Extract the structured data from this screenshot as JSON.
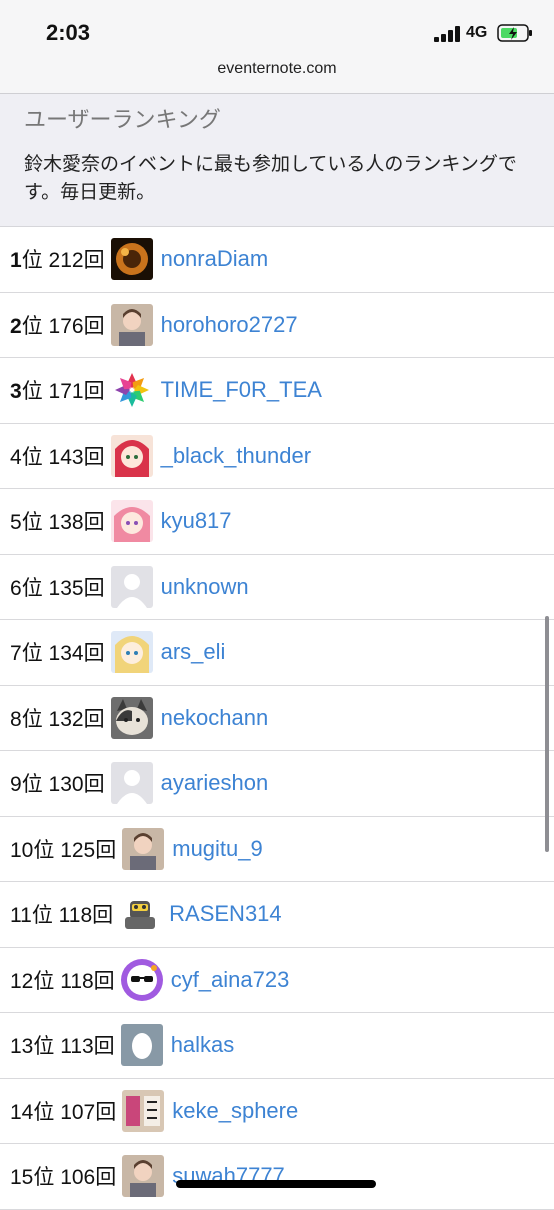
{
  "status_bar": {
    "time": "2:03",
    "network": "4G"
  },
  "browser": {
    "url": "eventernote.com"
  },
  "header": {
    "title": "ユーザーランキング",
    "description": "鈴木愛奈のイベントに最も参加している人のランキングです。毎日更新。"
  },
  "ranking": [
    {
      "rank": "1",
      "rank_suffix": "位",
      "count": "212回",
      "user": "nonraDiam",
      "avatar_icon": "dark-orange-avatar"
    },
    {
      "rank": "2",
      "rank_suffix": "位",
      "count": "176回",
      "user": "horohoro2727",
      "avatar_icon": "photo-avatar"
    },
    {
      "rank": "3",
      "rank_suffix": "位",
      "count": "171回",
      "user": "TIME_F0R_TEA",
      "avatar_icon": "flower-avatar"
    },
    {
      "rank": "4",
      "rank_suffix": "位",
      "count": "143回",
      "user": "_black_thunder",
      "avatar_icon": "anime-red-avatar"
    },
    {
      "rank": "5",
      "rank_suffix": "位",
      "count": "138回",
      "user": "kyu817",
      "avatar_icon": "anime-pink-avatar"
    },
    {
      "rank": "6",
      "rank_suffix": "位",
      "count": "135回",
      "user": "unknown",
      "avatar_icon": "default-avatar"
    },
    {
      "rank": "7",
      "rank_suffix": "位",
      "count": "134回",
      "user": "ars_eli",
      "avatar_icon": "anime-blonde-avatar"
    },
    {
      "rank": "8",
      "rank_suffix": "位",
      "count": "132回",
      "user": "nekochann",
      "avatar_icon": "cat-avatar"
    },
    {
      "rank": "9",
      "rank_suffix": "位",
      "count": "130回",
      "user": "ayarieshon",
      "avatar_icon": "default-avatar"
    },
    {
      "rank": "10",
      "rank_suffix": "位",
      "count": "125回",
      "user": "mugitu_9",
      "avatar_icon": "photo-avatar"
    },
    {
      "rank": "11",
      "rank_suffix": "位",
      "count": "118回",
      "user": "RASEN314",
      "avatar_icon": "robot-avatar"
    },
    {
      "rank": "12",
      "rank_suffix": "位",
      "count": "118回",
      "user": "cyf_aina723",
      "avatar_icon": "sunglasses-avatar"
    },
    {
      "rank": "13",
      "rank_suffix": "位",
      "count": "113回",
      "user": "halkas",
      "avatar_icon": "egg-avatar"
    },
    {
      "rank": "14",
      "rank_suffix": "位",
      "count": "107回",
      "user": "keke_sphere",
      "avatar_icon": "text-avatar"
    },
    {
      "rank": "15",
      "rank_suffix": "位",
      "count": "106回",
      "user": "suwah7777",
      "avatar_icon": "photo-avatar"
    }
  ],
  "colors": {
    "link": "#3d83d3",
    "header_bg": "#efeff4",
    "divider": "#d9d9dc"
  }
}
